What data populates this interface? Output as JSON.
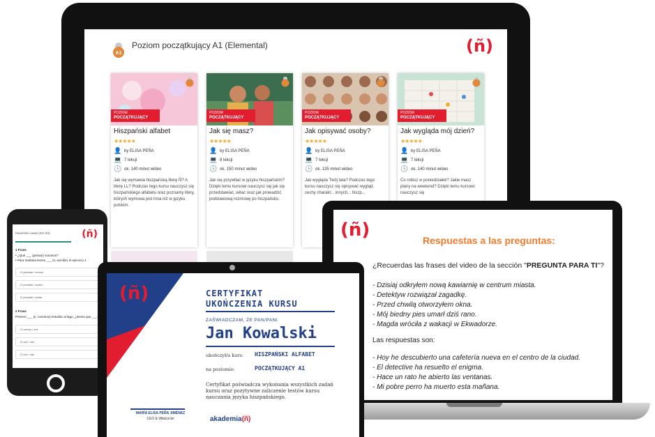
{
  "course_page": {
    "title": "Poziom początkujący A1 (Elemental)",
    "badge": "A1",
    "logo": "(ñ)",
    "tag_line1": "POZIOM",
    "tag_line2": "POCZĄTKUJĄCY",
    "cards": [
      {
        "title": "Hiszpański alfabet",
        "stars": "★★★★★",
        "author": "by ELISA PEÑA",
        "lessons": "7 lekcji",
        "video": "ok. 140 minut wideo",
        "desc": "Jak się wymawia hiszpańską literę Ñ? A literę LL? Podczas tego kursu nauczysz się hiszpańskiego alfabetu oraz poznamy litery, których wymowa jest inna niż w języku polskim.",
        "img_color": "#f6c7d8"
      },
      {
        "title": "Jak się masz?",
        "stars": "★★★★★",
        "author": "by ELISA PEÑA",
        "lessons": "8 lekcji",
        "video": "ok. 150 minut wideo",
        "desc": "Jak się przywitać w języku hiszpańskim? Dzięki temu kursowi nauczysz się jak się przedstawiać, witać oraz jak prowadzić podstawową rozmowę po hiszpańsku.",
        "img_color": "#3b6e4e"
      },
      {
        "title": "Jak opisywać osoby?",
        "stars": "★★★★★",
        "author": "by ELISA PEÑA",
        "lessons": "7 lekcji",
        "video": "ok. 135 minut wideo",
        "desc": "Jak wygląda Twój tata? Podczas tego kursu nauczysz się opisywać wygląd, cechy charakt... innych... hiszp...",
        "img_color": "#b98a6c"
      },
      {
        "title": "Jak wygląda mój dzień?",
        "stars": "★★★★★",
        "author": "by ELISA PEÑA",
        "lessons": "7 lekcji",
        "video": "ok. 140 minut wideo",
        "desc": "Co robisz w poniedziałek? Jakie masz plany na weekend? Dzięki temu kursowi nauczysz się",
        "img_color": "#c9e3d6"
      }
    ]
  },
  "answers_slide": {
    "logo": "(ñ)",
    "heading": "Respuestas a las preguntas:",
    "question_pre": "¿Recuerdas las frases del video de la sección \"",
    "question_bold": "PREGUNTA PARA TI",
    "question_post": "\"?",
    "sentences": [
      "- Dzisiaj odkryłem nową kawiarnię w centrum miasta.",
      "- Detektyw rozwiązał zagadkę.",
      "- Przed chwilą otworzyłem okna.",
      "- Mój biedny pies umarł dziś rano.",
      "- Magda wróciła z wakacji w Ekwadorze."
    ],
    "answers_label": "Las respuestas son:",
    "answers": [
      "- Hoy he descubierto una cafetería nueva en el centro de la ciudad.",
      "- El detective ha resuelto el enigma.",
      "- Hace un rato he abierto las ventanas.",
      "- Mi pobre perro ha muerto esta mañana."
    ]
  },
  "phone_quiz": {
    "logo": "(ñ)",
    "ref": "Haciendo cosas (SH 3/4)",
    "q1": "1 Frase",
    "q1_lines": [
      "• ¿Qué ___ (pensar) vosotros?",
      "• Para mañana tienes ___ (ir, escribir) el ejercicio 4"
    ],
    "q1_options": [
      "O piensas / vemos",
      "O pensáis / veréis",
      "O pensáis / verás"
    ],
    "q2": "2 Frase",
    "q2_line": "Primero ___ (ir, nosotros) estudiar al lago, ¿tienes que ___?",
    "q2_options": [
      "O vamos / ves",
      "O van / ves",
      "O ves / vas"
    ]
  },
  "certificate": {
    "logo": "(ñ)",
    "title_line1": "CERTYFIKAT",
    "title_line2": "UKOŃCZENIA KURSU",
    "certify": "ZAŚWIADCZAM, ŻE PAN/PANI",
    "name": "Jan Kowalski",
    "course_label": "ukończył/a kurs:",
    "course_value": "HISZPAŃSKI ALFABET",
    "level_label": "na poziomie:",
    "level_value": "POCZĄTKUJĄCY A1",
    "body": "Certyfikat poświadcza wykonania wszystkich zadań kursu oraz pozytywne zaliczenie testów kursu nauczania języka hiszpańskiego.",
    "signer": "MARÍA ELISA PEÑA JIMÉNEZ",
    "signer_role": "CEO & Właściciel",
    "brand_main": "akademia",
    "brand_logo": "(ñ)"
  },
  "colors": {
    "brand_red": "#e21d2f",
    "navy": "#22408a",
    "orange_heading": "#f07b2b",
    "star": "#f5a623"
  }
}
